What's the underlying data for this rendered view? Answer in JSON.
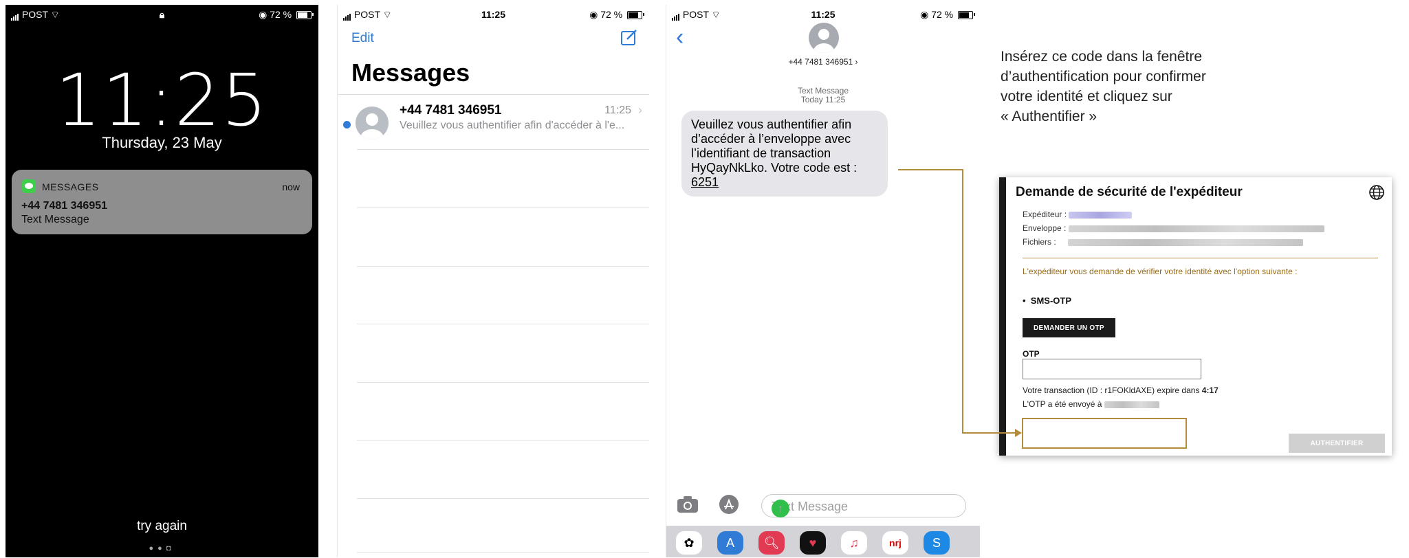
{
  "colors": {
    "accent": "#2f7bd6",
    "gold": "#b28b3b",
    "dark": "#1b1b1b",
    "send_green": "#2fbf4a",
    "unread_dot": "#2f7bd6"
  },
  "phone1": {
    "status": {
      "carrier": "POST",
      "battery": "72 %"
    },
    "clock": "11:25",
    "date": "Thursday, 23 May",
    "notification": {
      "app": "MESSAGES",
      "time": "now",
      "sender": "+44 7481 346951",
      "body": "Text Message"
    },
    "bottom": "try again"
  },
  "phone2": {
    "status": {
      "carrier": "POST",
      "time": "11:25",
      "battery": "72 %"
    },
    "edit": "Edit",
    "title": "Messages",
    "conversation": {
      "sender": "+44 7481 346951",
      "time": "11:25",
      "preview": "Veuillez vous authentifier afin d'accéder à l'e..."
    }
  },
  "phone3": {
    "status": {
      "carrier": "POST",
      "time": "11:25",
      "battery": "72 %"
    },
    "contact": "+44 7481 346951 ›",
    "meta_type": "Text Message",
    "meta_time": "Today 11:25",
    "message_lines": [
      "Veuillez vous authentifier afin",
      "d’accéder à l’enveloppe avec",
      "l’identifiant de transaction"
    ],
    "message_last": "HyQayNkLko. Votre code est : ",
    "code": "6251",
    "input_placeholder": "Text Message",
    "tray_apps": [
      "photos-app-icon",
      "appstore-app-icon",
      "search-app-icon",
      "heart-app-icon",
      "music-app-icon",
      "nrj-app-icon",
      "shazam-app-icon"
    ]
  },
  "instructions": {
    "lines": [
      "Insérez ce code dans la fenêtre",
      "d’authentification pour confirmer",
      "votre identité et cliquez sur",
      "« Authentifier »"
    ]
  },
  "dialog": {
    "title": "Demande de sécurité de l'expéditeur",
    "sender_label": "Expéditeur :",
    "envelope_label": "Enveloppe :",
    "files_label": "Fichiers :",
    "note": "L'expéditeur vous demande de vérifier votre identité avec l'option suivante :",
    "option": "SMS-OTP",
    "request_button": "DEMANDER UN OTP",
    "otp_label": "OTP",
    "tx_prefix": "Votre transaction (ID : r1FOKldAXE) expire dans ",
    "tx_time": "4:17",
    "sent_prefix": "L'OTP a été envoyé à",
    "auth_button": "AUTHENTIFIER"
  }
}
